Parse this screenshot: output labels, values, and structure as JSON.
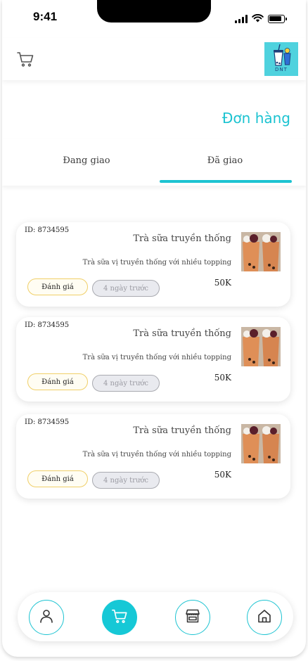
{
  "status_bar": {
    "time": "9:41"
  },
  "header": {
    "logo_text": "DNT"
  },
  "page_title": "Đơn hàng",
  "tabs": [
    {
      "label": "Đang giao",
      "active": false
    },
    {
      "label": "Đã giao",
      "active": true
    }
  ],
  "orders": [
    {
      "id": "ID: 8734595",
      "name": "Trà sữa truyền thống",
      "description": "Trà sữa vị truyền thống với nhiều topping",
      "price": "50K",
      "rate_label": "Đánh giá",
      "time_ago": "4 ngày trước"
    },
    {
      "id": "ID: 8734595",
      "name": "Trà sữa truyền thống",
      "description": "Trà sữa vị truyền thống với nhiều topping",
      "price": "50K",
      "rate_label": "Đánh giá",
      "time_ago": "4 ngày trước"
    },
    {
      "id": "ID: 8734595",
      "name": "Trà sữa truyền thống",
      "description": "Trà sữa vị truyền thống với nhiều topping",
      "price": "50K",
      "rate_label": "Đánh giá",
      "time_ago": "4 ngày trước"
    }
  ],
  "bottom_nav": [
    {
      "icon": "user-icon",
      "active": false
    },
    {
      "icon": "cart-icon",
      "active": true
    },
    {
      "icon": "store-icon",
      "active": false
    },
    {
      "icon": "home-icon",
      "active": false
    }
  ],
  "colors": {
    "accent": "#1cc3d1",
    "rate_border": "#f0cf68",
    "badge_bg": "#e9eaef"
  }
}
